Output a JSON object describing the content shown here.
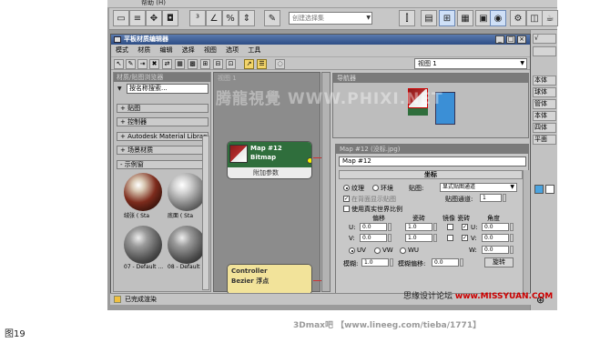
{
  "max_window": {
    "menu_partial": "帮助 (H)",
    "selection_set_placeholder": "创建选择集",
    "right_panel_items": [
      "√",
      "",
      "本体",
      "球体",
      "管体",
      "本体",
      "四体",
      "平面"
    ]
  },
  "editor": {
    "title": "平板材质编辑器",
    "menu": [
      "模式",
      "材质",
      "编辑",
      "选择",
      "视图",
      "选项",
      "工具"
    ],
    "view_select": "视图 1",
    "minimize_label": "_",
    "maximize_label": "□",
    "close_label": "×"
  },
  "browser": {
    "title": "材质/贴图浏览器",
    "search_placeholder": "按名称搜索...",
    "categories": [
      "+ 贴图",
      "+ 控制器",
      "+ Autodesk Material Library",
      "+ 场景材质",
      "- 示例窗"
    ],
    "samples": [
      {
        "label": "绒张 ( Sta",
        "type": "red"
      },
      {
        "label": "底面 ( Sta",
        "type": "gray"
      },
      {
        "label": "07 - Default ...",
        "type": "dark"
      },
      {
        "label": "08 - Default ...",
        "type": "dark"
      }
    ]
  },
  "view_area": {
    "label": "视图 1",
    "node_map": {
      "line1": "Map #12",
      "line2": "Bitmap",
      "param": "附加参数"
    },
    "node_controller": {
      "line1": "Controller",
      "line2": "Bezier 浮点"
    }
  },
  "navigator": {
    "title": "导航器"
  },
  "properties": {
    "title": "Map #12 (没标.jpg)",
    "name": "Map #12",
    "rollout": "坐标",
    "texture_label": "纹理",
    "env_label": "环境",
    "mapping_label": "贴图:",
    "mapping_value": "显式贴图通道",
    "show_back_label": "在背面显示贴图",
    "map_channel_label": "贴图通道:",
    "map_channel_value": "1",
    "real_world_label": "使用真实世界比例",
    "col_offset": "偏移",
    "col_tiling": "瓷砖",
    "col_mirror_tile": "镜像 瓷砖",
    "col_angle": "角度",
    "u_label": "U:",
    "v_label": "V:",
    "w_label": "W:",
    "u_offset": "0.0",
    "u_tiling": "1.0",
    "u_angle": "0.0",
    "v_offset": "0.0",
    "v_tiling": "1.0",
    "v_angle": "0.0",
    "w_angle": "0.0",
    "uv_label": "UV",
    "vw_label": "VW",
    "wu_label": "WU",
    "blur_label": "模糊:",
    "blur_value": "1.0",
    "blur_offset_label": "模糊偏移:",
    "blur_offset_value": "0.0",
    "rotate_label": "旋转"
  },
  "status": {
    "text": "已完成渲染"
  },
  "watermarks": {
    "center": "腾龍視覺  WWW.PHIXI.NET"
  },
  "corner_watermark": {
    "prefix": "思缘设计论坛 ",
    "red": "www.MISSYUAN.COM"
  },
  "caption": "图19",
  "credit": "3Dmax吧 【www.lineeg.com/tieba/1771】"
}
